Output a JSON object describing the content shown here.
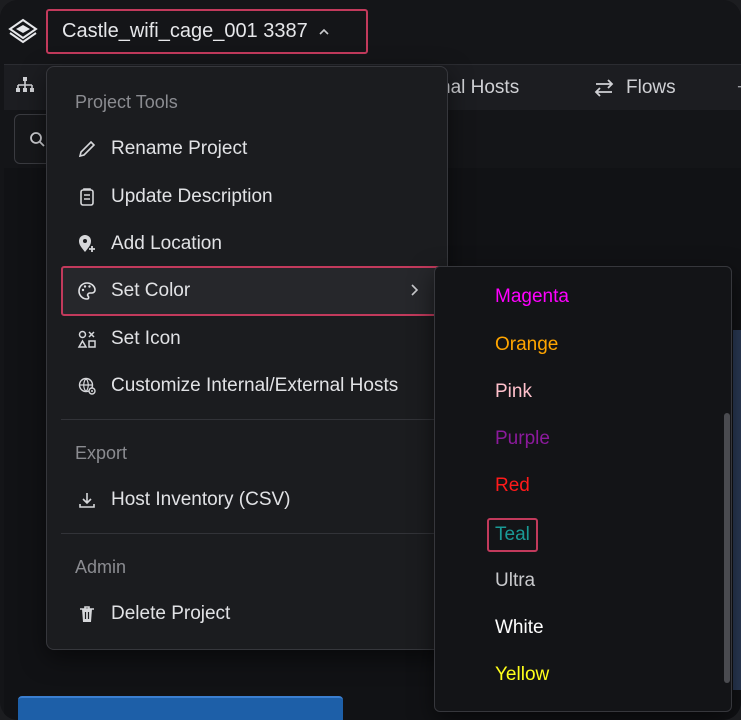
{
  "header": {
    "project_title": "Castle_wifi_cage_001 3387"
  },
  "tabs": {
    "hosts": "nal Hosts",
    "flows": "Flows",
    "more": "+"
  },
  "menu": {
    "sections": {
      "project_tools": "Project Tools",
      "export": "Export",
      "admin": "Admin"
    },
    "items": {
      "rename": "Rename Project",
      "update_description": "Update Description",
      "add_location": "Add Location",
      "set_color": "Set Color",
      "set_icon": "Set Icon",
      "customize_hosts": "Customize Internal/External Hosts",
      "host_inventory": "Host Inventory (CSV)",
      "delete": "Delete Project"
    }
  },
  "colors": {
    "items": [
      {
        "label": "Magenta",
        "color": "#ff00ff"
      },
      {
        "label": "Orange",
        "color": "#ffa500"
      },
      {
        "label": "Pink",
        "color": "#ffc0cb"
      },
      {
        "label": "Purple",
        "color": "#8b1a9c"
      },
      {
        "label": "Red",
        "color": "#ff1a1a"
      },
      {
        "label": "Teal",
        "color": "#1a9a96"
      },
      {
        "label": "Ultra",
        "color": "#c8c9cc"
      },
      {
        "label": "White",
        "color": "#ffffff"
      },
      {
        "label": "Yellow",
        "color": "#ffff1a"
      }
    ],
    "selected": "Teal"
  },
  "accent": "#c23a5c"
}
